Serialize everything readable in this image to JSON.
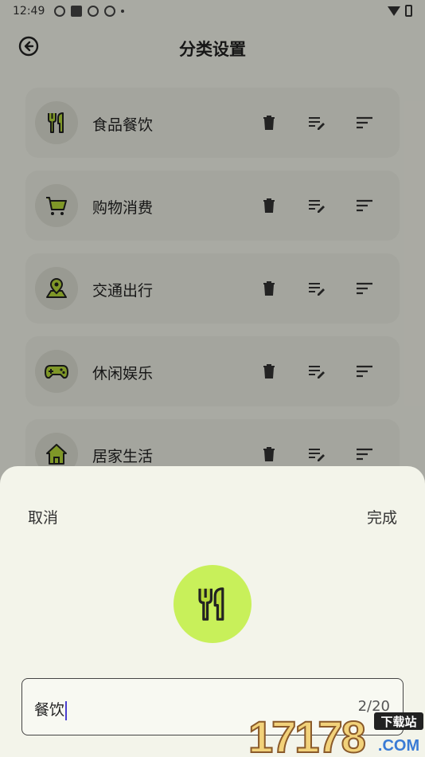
{
  "status": {
    "time": "12:49"
  },
  "header": {
    "title": "分类设置",
    "back_icon": "back-arrow-circle-icon"
  },
  "categories": [
    {
      "name": "食品餐饮",
      "icon": "fork-knife-icon"
    },
    {
      "name": "购物消费",
      "icon": "shopping-cart-icon"
    },
    {
      "name": "交通出行",
      "icon": "location-pin-icon"
    },
    {
      "name": "休闲娱乐",
      "icon": "gamepad-icon"
    },
    {
      "name": "居家生活",
      "icon": "house-icon"
    }
  ],
  "actions": {
    "delete_icon": "trash-icon",
    "edit_icon": "edit-list-icon",
    "sort_icon": "sort-icon"
  },
  "sheet": {
    "cancel_label": "取消",
    "done_label": "完成",
    "selected_icon": "fork-knife-icon",
    "input_value": "餐饮",
    "counter": "2/20"
  },
  "watermark": {
    "number": "17178",
    "site": "下载站",
    "domain": ".COM"
  },
  "colors": {
    "accent": "#c8f05a",
    "icon_accent": "#b6d83a",
    "background": "#f3f4ea"
  }
}
